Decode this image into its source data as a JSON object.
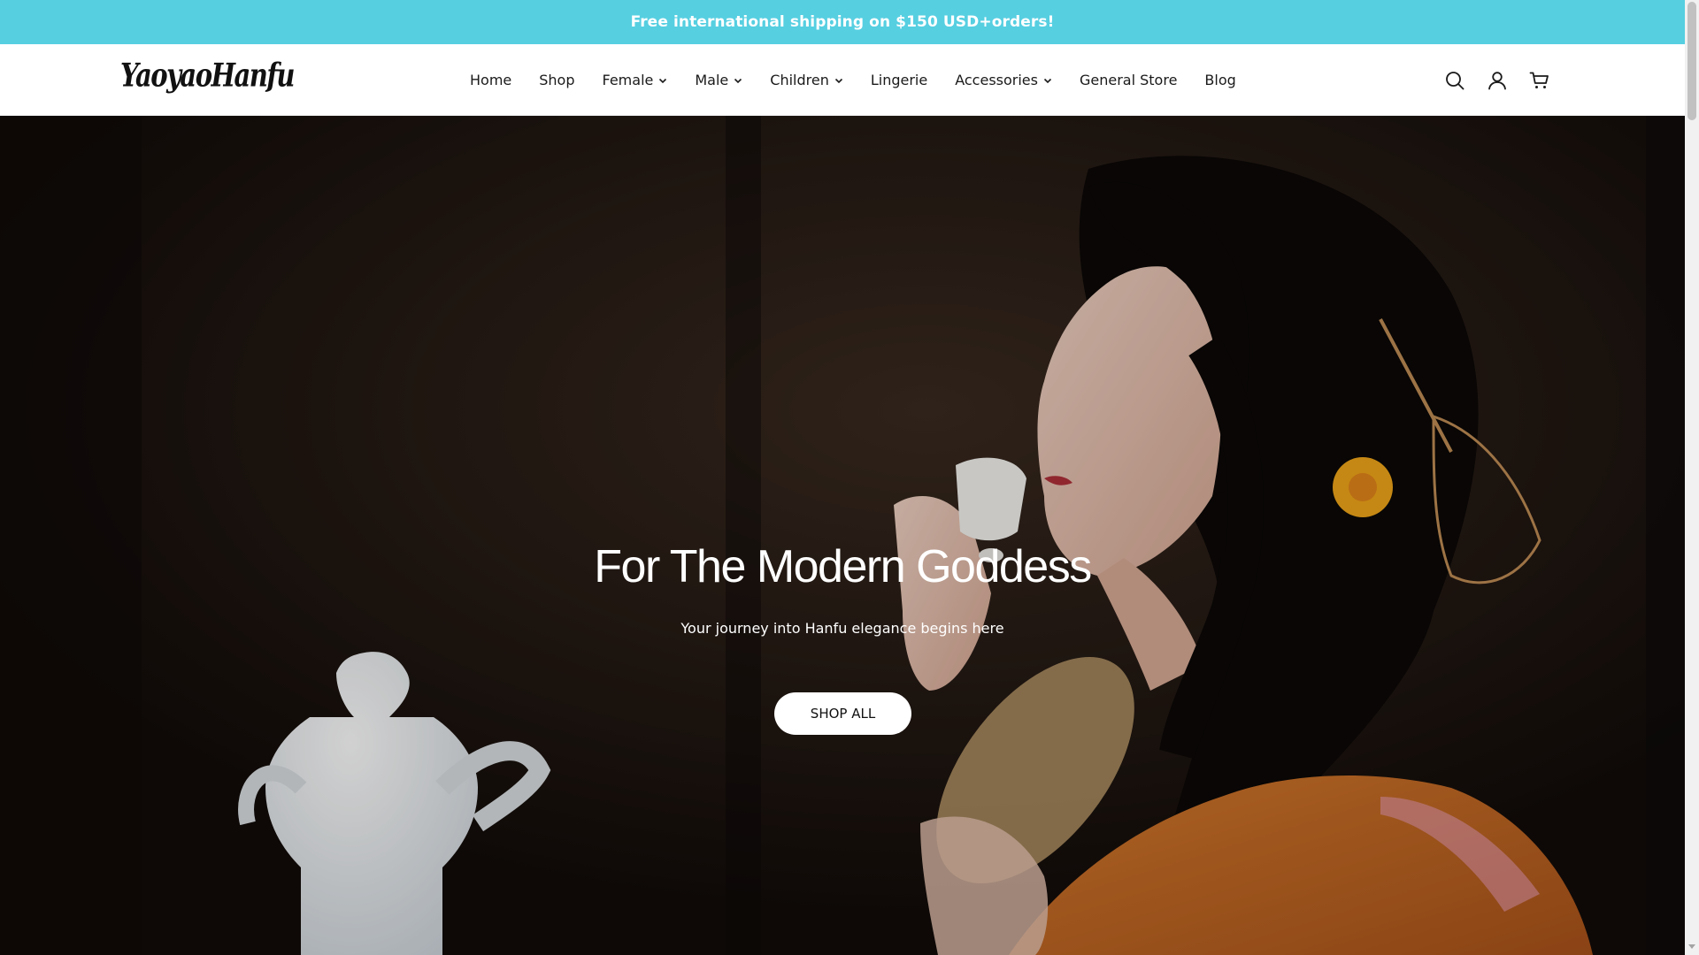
{
  "announcement": {
    "text": "Free international shipping on $150 USD+orders!",
    "background_color": "#56cfe1"
  },
  "header": {
    "logo_text": "YaoyaoHanfu",
    "nav": [
      {
        "label": "Home",
        "has_dropdown": false
      },
      {
        "label": "Shop",
        "has_dropdown": false
      },
      {
        "label": "Female",
        "has_dropdown": true
      },
      {
        "label": "Male",
        "has_dropdown": true
      },
      {
        "label": "Children",
        "has_dropdown": true
      },
      {
        "label": "Lingerie",
        "has_dropdown": false
      },
      {
        "label": "Accessories",
        "has_dropdown": true
      },
      {
        "label": "General Store",
        "has_dropdown": false
      },
      {
        "label": "Blog",
        "has_dropdown": false
      }
    ],
    "icons": [
      "search-icon",
      "account-icon",
      "cart-icon"
    ]
  },
  "hero": {
    "title": "For The Modern Goddess",
    "subtitle": "Your journey into Hanfu elegance begins here",
    "cta_label": "SHOP ALL",
    "image_description_colors": {
      "background": "#150f0c",
      "robe": "#c86a22",
      "skin": "#e6c2b0"
    }
  }
}
